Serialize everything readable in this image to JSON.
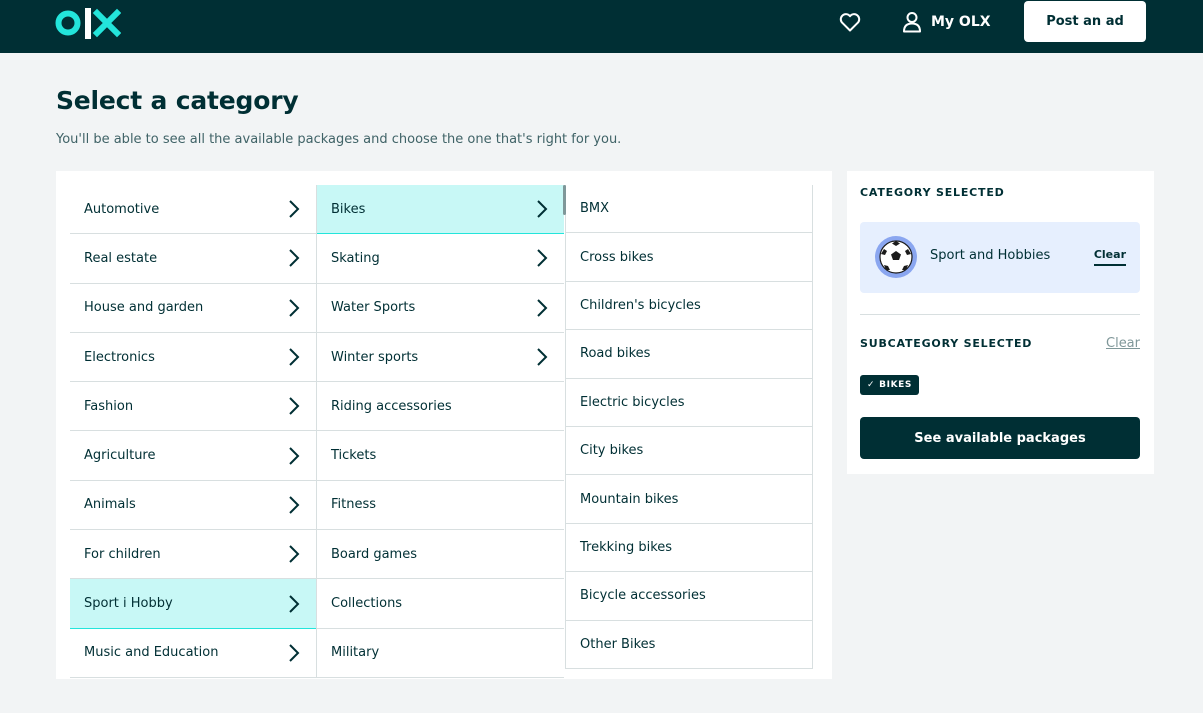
{
  "header": {
    "logo_text": "OLX",
    "my_olx_label": "My OLX",
    "post_ad_label": "Post an ad"
  },
  "page": {
    "title": "Select a category",
    "subtitle": "You'll be able to see all the available packages and choose the one that's right for you."
  },
  "categories": [
    {
      "label": "Automotive",
      "has_children": true,
      "selected": false
    },
    {
      "label": "Real estate",
      "has_children": true,
      "selected": false
    },
    {
      "label": "House and garden",
      "has_children": true,
      "selected": false
    },
    {
      "label": "Electronics",
      "has_children": true,
      "selected": false
    },
    {
      "label": "Fashion",
      "has_children": true,
      "selected": false
    },
    {
      "label": "Agriculture",
      "has_children": true,
      "selected": false
    },
    {
      "label": "Animals",
      "has_children": true,
      "selected": false
    },
    {
      "label": "For children",
      "has_children": true,
      "selected": false
    },
    {
      "label": "Sport i Hobby",
      "has_children": true,
      "selected": true
    },
    {
      "label": "Music and Education",
      "has_children": true,
      "selected": false
    }
  ],
  "subcategories": [
    {
      "label": "Bikes",
      "has_children": true,
      "selected": true
    },
    {
      "label": "Skating",
      "has_children": true,
      "selected": false
    },
    {
      "label": "Water Sports",
      "has_children": true,
      "selected": false
    },
    {
      "label": "Winter sports",
      "has_children": true,
      "selected": false
    },
    {
      "label": "Riding accessories",
      "has_children": false,
      "selected": false
    },
    {
      "label": "Tickets",
      "has_children": false,
      "selected": false
    },
    {
      "label": "Fitness",
      "has_children": false,
      "selected": false
    },
    {
      "label": "Board games",
      "has_children": false,
      "selected": false
    },
    {
      "label": "Collections",
      "has_children": false,
      "selected": false
    },
    {
      "label": "Military",
      "has_children": false,
      "selected": false
    }
  ],
  "bike_types": [
    {
      "label": "BMX"
    },
    {
      "label": "Cross bikes"
    },
    {
      "label": "Children's bicycles"
    },
    {
      "label": "Road bikes"
    },
    {
      "label": "Electric bicycles"
    },
    {
      "label": "City bikes"
    },
    {
      "label": "Mountain bikes"
    },
    {
      "label": "Trekking bikes"
    },
    {
      "label": "Bicycle accessories"
    },
    {
      "label": "Other Bikes"
    }
  ],
  "sidebar": {
    "category_heading": "CATEGORY SELECTED",
    "category_name": "Sport and Hobbies",
    "category_clear": "Clear",
    "subcategory_heading": "SUBCATEGORY SELECTED",
    "subcategory_clear": "Clear",
    "subcategory_tag": "BIKES",
    "cta_label": "See available packages"
  },
  "colors": {
    "brand_dark": "#002f34",
    "selected_row": "#c8f8f6",
    "category_box": "#e6effe",
    "logo_teal": "#23e5db"
  }
}
